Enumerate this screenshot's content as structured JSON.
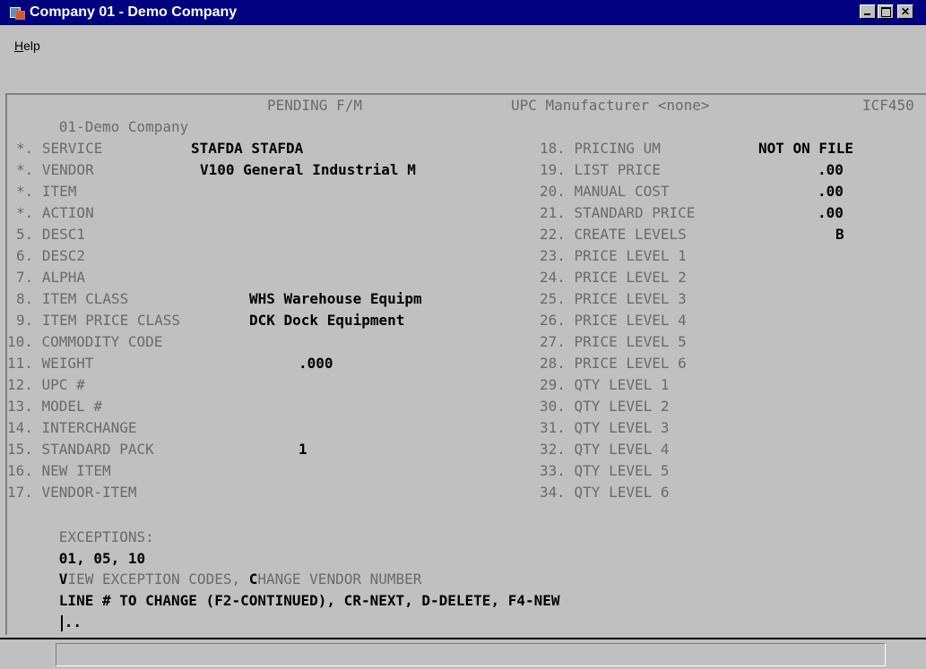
{
  "window": {
    "title": "Company 01 - Demo Company",
    "icon": "app-icon",
    "buttons": [
      "minimize-icon",
      "maximize-icon",
      "close-icon"
    ]
  },
  "menu": {
    "help_label": "Help",
    "help_mnemonic": "H",
    "help_rest": "elp"
  },
  "screen": {
    "company": "01-Demo Company",
    "mode": "PENDING F/M",
    "upc_manufacturer": "UPC Manufacturer <none>",
    "program_id": "ICF450",
    "left_fields": [
      {
        "label": "*. SERVICE",
        "value": "STAFDA STAFDA"
      },
      {
        "label": "*. VENDOR",
        "value": "V100 General Industrial M"
      },
      {
        "label": "*. ITEM",
        "value": ""
      },
      {
        "label": "*. ACTION",
        "value": ""
      },
      {
        "label": "5. DESC1",
        "value": ""
      },
      {
        "label": "6. DESC2",
        "value": ""
      },
      {
        "label": "7. ALPHA",
        "value": ""
      },
      {
        "label": "8. ITEM CLASS",
        "value": "WHS Warehouse Equipm"
      },
      {
        "label": "9. ITEM PRICE CLASS",
        "value": "DCK Dock Equipment"
      },
      {
        "label": "10. COMMODITY CODE",
        "value": ""
      },
      {
        "label": "11. WEIGHT",
        "value": ".000"
      },
      {
        "label": "12. UPC #",
        "value": ""
      },
      {
        "label": "13. MODEL #",
        "value": ""
      },
      {
        "label": "14. INTERCHANGE",
        "value": ""
      },
      {
        "label": "15. STANDARD PACK",
        "value": "1"
      },
      {
        "label": "16. NEW ITEM",
        "value": ""
      },
      {
        "label": "17. VENDOR-ITEM",
        "value": ""
      }
    ],
    "right_fields": [
      {
        "label": "18. PRICING UM",
        "value": "NOT ON FILE"
      },
      {
        "label": "19. LIST PRICE",
        "value": ".00"
      },
      {
        "label": "20. MANUAL COST",
        "value": ".00"
      },
      {
        "label": "21. STANDARD PRICE",
        "value": ".00"
      },
      {
        "label": "22. CREATE LEVELS",
        "value": "B"
      },
      {
        "label": "23. PRICE LEVEL 1",
        "value": ""
      },
      {
        "label": "24. PRICE LEVEL 2",
        "value": ""
      },
      {
        "label": "25. PRICE LEVEL 3",
        "value": ""
      },
      {
        "label": "26. PRICE LEVEL 4",
        "value": ""
      },
      {
        "label": "27. PRICE LEVEL 5",
        "value": ""
      },
      {
        "label": "28. PRICE LEVEL 6",
        "value": ""
      },
      {
        "label": "29. QTY LEVEL 1",
        "value": ""
      },
      {
        "label": "30. QTY LEVEL 2",
        "value": ""
      },
      {
        "label": "31. QTY LEVEL 3",
        "value": ""
      },
      {
        "label": "32. QTY LEVEL 4",
        "value": ""
      },
      {
        "label": "33. QTY LEVEL 5",
        "value": ""
      },
      {
        "label": "34. QTY LEVEL 6",
        "value": ""
      }
    ],
    "exceptions_label": "EXCEPTIONS:",
    "exceptions_value": "01, 05, 10",
    "options_line": {
      "view_key": "V",
      "view_rest": "IEW EXCEPTION CODES, ",
      "change_key": "C",
      "change_rest": "HANGE VENDOR NUMBER"
    },
    "prompt": "LINE # TO CHANGE (F2-CONTINUED), CR-NEXT, D-DELETE, F4-NEW",
    "prompt_input": ".."
  },
  "statusbar": {
    "text": ""
  }
}
